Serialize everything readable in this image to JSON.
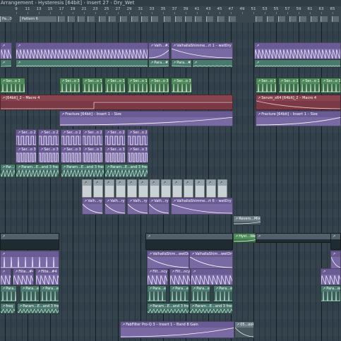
{
  "title": {
    "segments": [
      "Arrangement",
      "Hysteresis [64bit]",
      "Insert 27",
      "Dry_Wet"
    ],
    "separator": "›"
  },
  "ruler": {
    "bars": [
      "9",
      "11",
      "13",
      "15",
      "17",
      "19",
      "21",
      "23",
      "25",
      "27",
      "29",
      "31",
      "33",
      "35",
      "37",
      "39",
      "41",
      "43",
      "45",
      "47",
      "49",
      "51",
      "53",
      "55",
      "57",
      "59",
      "61",
      "63",
      "65",
      "67"
    ]
  },
  "markers": {
    "pattern_a": "Pa...0",
    "pattern_6": "Pattern 6"
  },
  "clips": {
    "valh2": "Valh...#2",
    "valhalla3": "ValhallaShimme...rt 1 – wetDry #3",
    "para2": "Para...#2",
    "serao3": "Ser...o 3",
    "serao1": "Ser...o 1",
    "macro4_left": "[64bit]_2 – Macro 4",
    "macro4_right": "Serum_x64 [64bit]_2 – Macro 4",
    "fracture": "Fracture [64bit] – Insert 1 – Size",
    "serao2": "Ser...o 2",
    "paramsfreq": "Param...E...and 3 freq",
    "parfreq": "Par...freq",
    "valhry": "Valh...ry",
    "valhalla6": "ValhallaShimme...rt 6 – wetDry #2",
    "reversmix": "Revers...Mix",
    "hystwet": "Hyst...Wet",
    "valhallashim": "ValhallaShim...wetDry #3",
    "filte4": "Filte...#4",
    "filtncy": "Filt...ncy",
    "paraeq": "Para...eq",
    "freqleft": "freq",
    "fabfilter": "FabFilter Pro-Q 3 – Insert 1 – Band 8 Gain",
    "osook": "05...ook"
  }
}
